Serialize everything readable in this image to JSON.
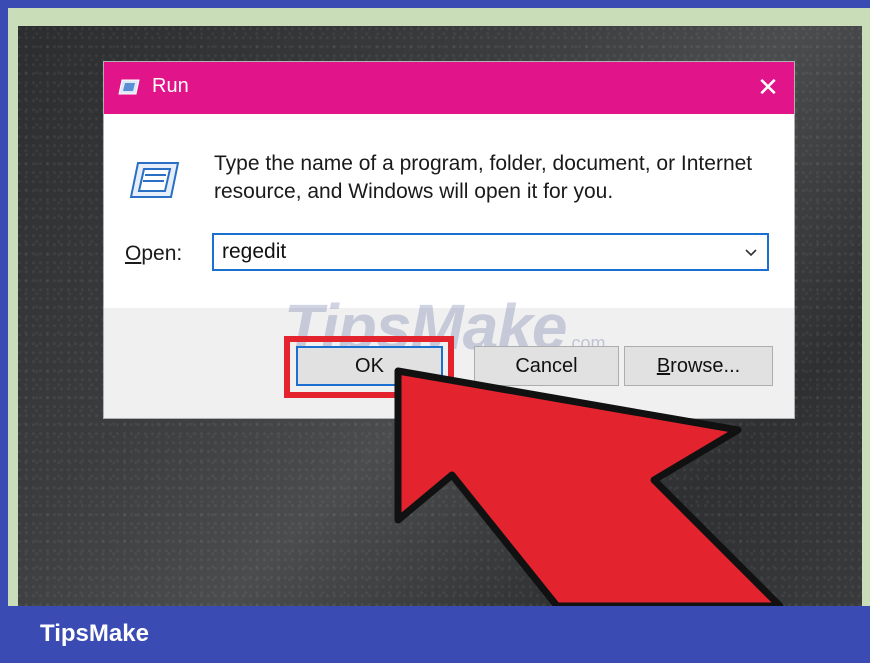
{
  "dialog": {
    "title": "Run",
    "close_glyph": "✕",
    "description": "Type the name of a program, folder, document, or Internet resource, and Windows will open it for you.",
    "open_label_prefix": "",
    "open_label_underlined": "O",
    "open_label_rest": "pen:",
    "open_value": "regedit",
    "ok_label": "OK",
    "cancel_label": "Cancel",
    "browse_label_underlined": "B",
    "browse_label_rest": "rowse..."
  },
  "icons": {
    "title_icon": "run-icon",
    "big_icon": "run-icon",
    "close": "close-icon",
    "dropdown": "chevron-down-icon",
    "pointer": "red-arrow-icon"
  },
  "watermark": {
    "text": "TipsMake",
    "sub": ".com"
  },
  "brand": {
    "name": "TipsMake"
  },
  "colors": {
    "titlebar": "#e1148a",
    "accent": "#1b6fd1",
    "highlight": "#e3242f",
    "brand_bar": "#3b4bb4"
  }
}
